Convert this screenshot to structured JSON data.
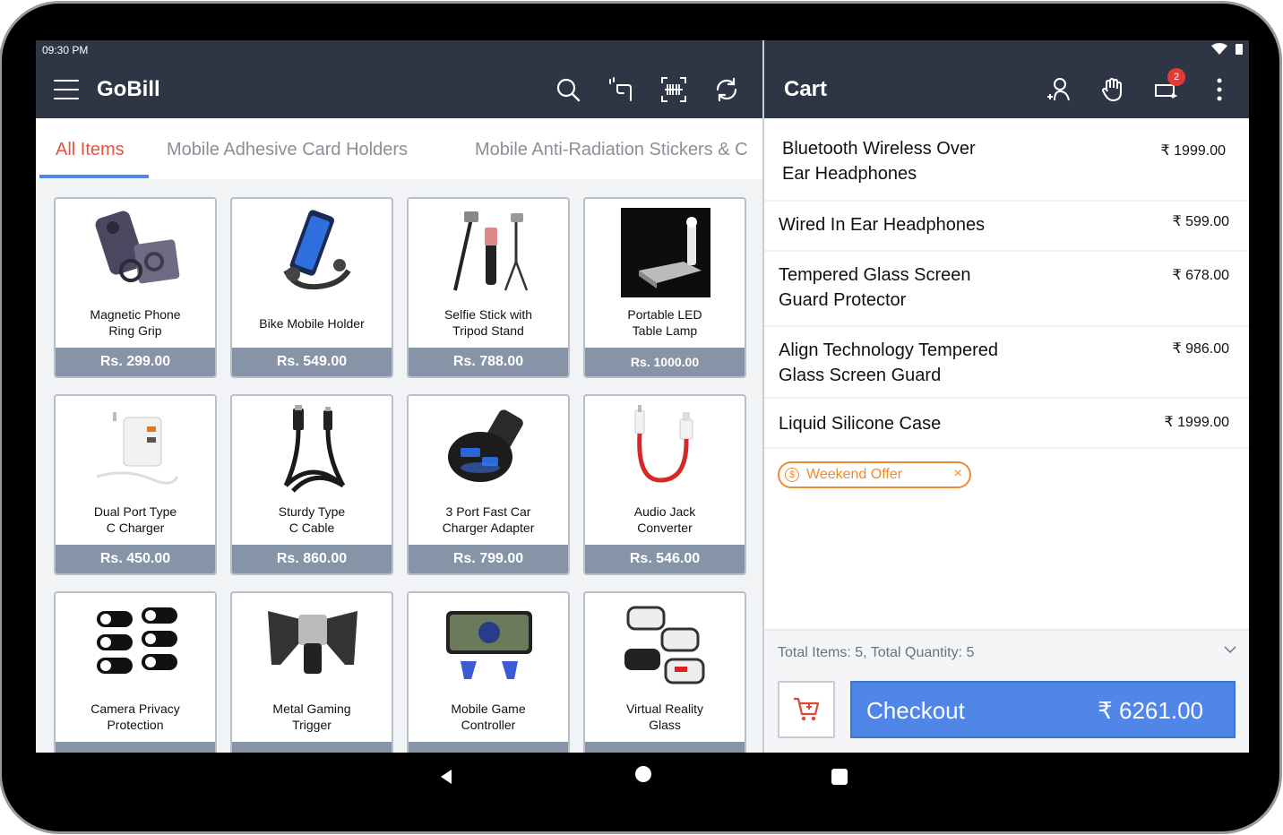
{
  "status": {
    "time": "09:30 PM"
  },
  "header": {
    "app_title": "GoBill"
  },
  "tabs": [
    "All Items",
    "Mobile Adhesive Card Holders",
    "Mobile Anti-Radiation Stickers & C"
  ],
  "products": [
    {
      "name_line1": "Magnetic Phone",
      "name_line2": "Ring Grip",
      "price": "Rs. 299.00"
    },
    {
      "name_line1": "Bike Mobile Holder",
      "name_line2": "",
      "price": "Rs. 549.00"
    },
    {
      "name_line1": "Selfie Stick with",
      "name_line2": "Tripod Stand",
      "price": "Rs. 788.00"
    },
    {
      "name_line1": "Portable LED",
      "name_line2": "Table Lamp",
      "price": "Rs. 1000.00"
    },
    {
      "name_line1": "Dual Port Type",
      "name_line2": "C Charger",
      "price": "Rs. 450.00"
    },
    {
      "name_line1": "Sturdy Type",
      "name_line2": "C Cable",
      "price": "Rs. 860.00"
    },
    {
      "name_line1": "3 Port Fast Car",
      "name_line2": "Charger Adapter",
      "price": "Rs. 799.00"
    },
    {
      "name_line1": "Audio Jack",
      "name_line2": "Converter",
      "price": "Rs. 546.00"
    },
    {
      "name_line1": "Camera Privacy",
      "name_line2": "Protection",
      "price": ""
    },
    {
      "name_line1": "Metal Gaming",
      "name_line2": "Trigger",
      "price": ""
    },
    {
      "name_line1": "Mobile Game",
      "name_line2": "Controller",
      "price": ""
    },
    {
      "name_line1": "Virtual Reality",
      "name_line2": "Glass",
      "price": ""
    }
  ],
  "cart": {
    "title": "Cart",
    "badge_count": "2",
    "items": [
      {
        "line1": "Bluetooth Wireless Over",
        "line2": "Ear Headphones",
        "price": "₹ 1999.00"
      },
      {
        "line1": "Wired In Ear Headphones",
        "line2": "",
        "price": "₹ 599.00"
      },
      {
        "line1": "Tempered Glass Screen",
        "line2": "Guard Protector",
        "price": "₹ 678.00"
      },
      {
        "line1": "Align Technology Tempered",
        "line2": "Glass Screen Guard",
        "price": "₹ 986.00"
      },
      {
        "line1": "Liquid Silicone Case",
        "line2": "",
        "price": "₹ 1999.00"
      }
    ],
    "offer": "Weekend Offer",
    "totals": "Total Items: 5, Total Quantity: 5",
    "checkout_label": "Checkout",
    "checkout_amount": "₹ 6261.00"
  },
  "colors": {
    "header_bg": "#2e3646",
    "accent": "#4f86e8",
    "tab_active": "#e4543f",
    "offer": "#ee8a32"
  },
  "icons": [
    "menu-icon",
    "search-icon",
    "scan-hand-icon",
    "barcode-icon",
    "refresh-icon",
    "add-customer-icon",
    "hand-icon",
    "hold-cart-icon",
    "more-icon",
    "cart-icon",
    "chevron-down-icon"
  ]
}
